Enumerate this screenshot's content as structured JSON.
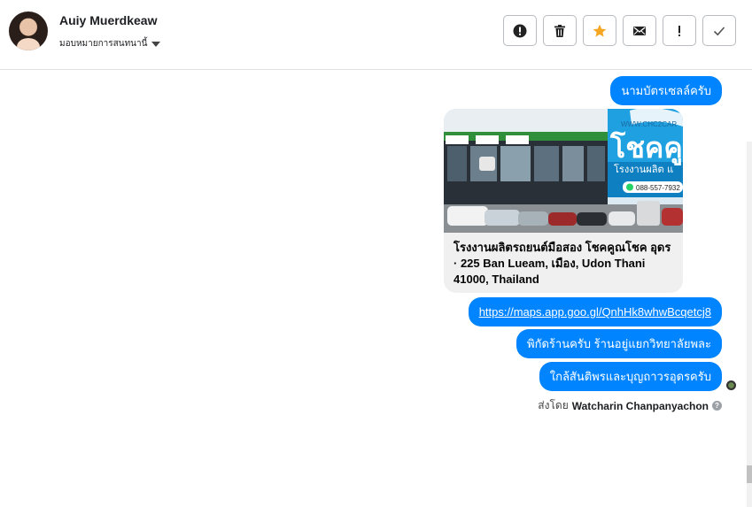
{
  "contact": {
    "name": "Auiy Muerdkeaw",
    "assign_label": "มอบหมายการสนทนานี้"
  },
  "actions": [
    {
      "name": "mark-spam-button",
      "icon": "alert-circle-icon"
    },
    {
      "name": "delete-button",
      "icon": "trash-icon"
    },
    {
      "name": "star-button",
      "icon": "star-icon"
    },
    {
      "name": "mark-unread-button",
      "icon": "envelope-icon"
    },
    {
      "name": "follow-up-button",
      "icon": "exclamation-icon"
    },
    {
      "name": "mark-done-button",
      "icon": "check-icon"
    }
  ],
  "messages": {
    "m1": "นามบัตรเซลล์ครับ",
    "card": {
      "title": "โรงงานผลิตรถยนต์มือสอง โชคคูณโชค อุดร · 225 Ban Lueam, เมือง, Udon Thani 41000, Thailand",
      "image_text": {
        "brand": "โชคคู",
        "sub": "โรงงานผลิต แ",
        "phone": "088-557-7932",
        "url": "WWW.CHC2CAR"
      }
    },
    "link": "https://maps.app.goo.gl/QnhHk8whwBcqetcj8",
    "m3": "พิกัดร้านครับ ร้านอยู่แยกวิทยาลัยพละ",
    "m4": "ใกล้สันติพรและบุญถาวรอุดรครับ"
  },
  "sent_by": {
    "prefix": "ส่งโดย",
    "name": "Watcharin Chanpanyachon"
  },
  "colors": {
    "bubble": "#0084ff",
    "star": "#f5a623"
  }
}
